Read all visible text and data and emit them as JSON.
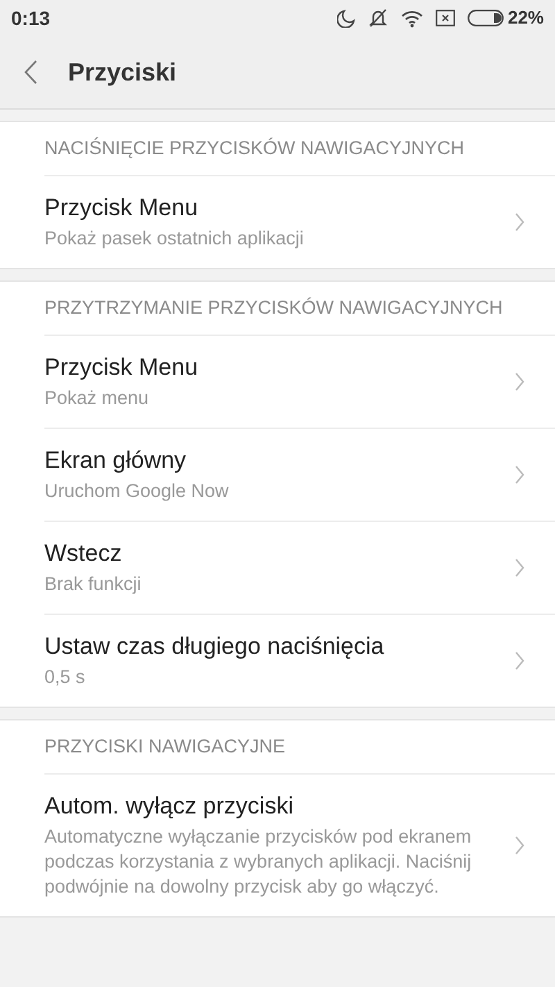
{
  "status_bar": {
    "time": "0:13",
    "battery": "22%"
  },
  "header": {
    "title": "Przyciski"
  },
  "sections": [
    {
      "title": "NACIŚNIĘCIE PRZYCISKÓW NAWIGACYJNYCH",
      "items": [
        {
          "title": "Przycisk Menu",
          "subtitle": "Pokaż pasek ostatnich aplikacji"
        }
      ]
    },
    {
      "title": "PRZYTRZYMANIE PRZYCISKÓW NAWIGACYJNYCH",
      "items": [
        {
          "title": "Przycisk Menu",
          "subtitle": "Pokaż menu"
        },
        {
          "title": "Ekran główny",
          "subtitle": "Uruchom Google Now"
        },
        {
          "title": "Wstecz",
          "subtitle": "Brak funkcji"
        },
        {
          "title": "Ustaw czas długiego naciśnięcia",
          "subtitle": "0,5 s"
        }
      ]
    },
    {
      "title": "PRZYCISKI NAWIGACYJNE",
      "items": [
        {
          "title": "Autom. wyłącz przyciski",
          "subtitle": "Automatyczne wyłączanie przycisków pod ekranem podczas korzystania z wybranych aplikacji. Naciśnij podwójnie na dowolny przycisk aby go włączyć."
        }
      ]
    }
  ]
}
